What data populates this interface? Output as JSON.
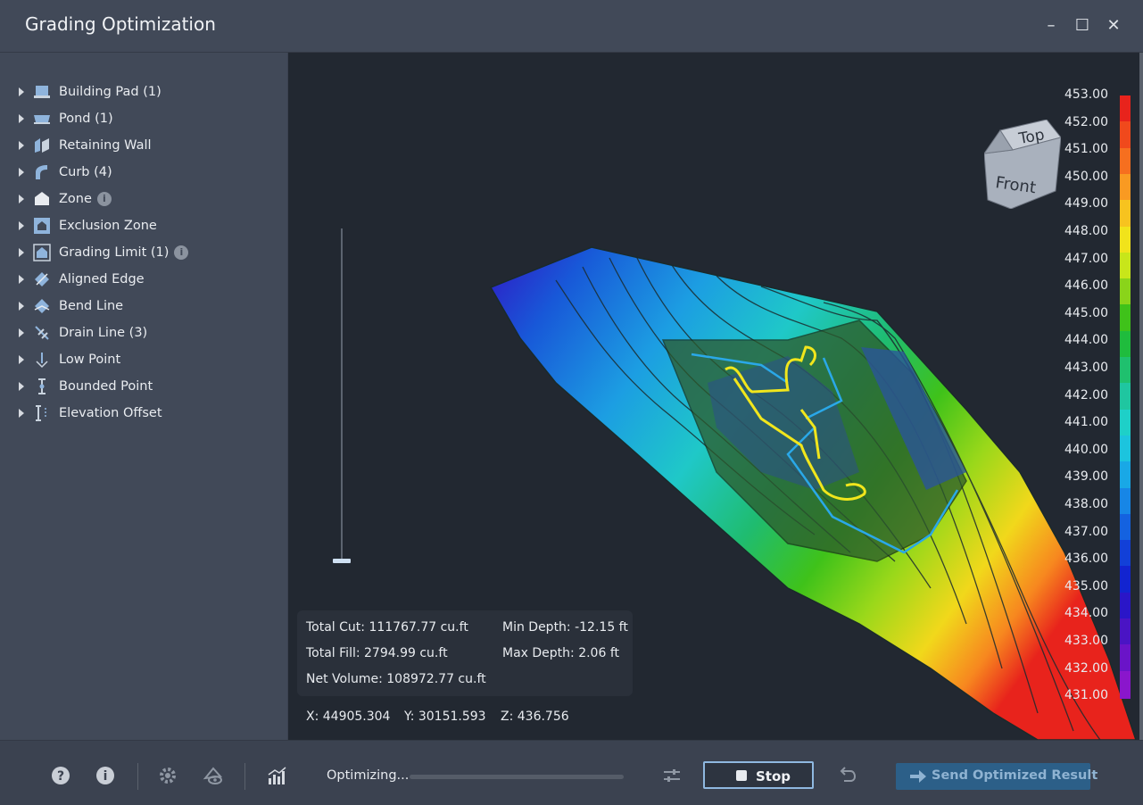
{
  "window": {
    "title": "Grading Optimization",
    "controls": {
      "minimize": "–",
      "maximize": "☐",
      "close": "✕"
    }
  },
  "sidebar": {
    "items": [
      {
        "label": "Building Pad (1)",
        "icon": "building-pad-icon",
        "info": false
      },
      {
        "label": "Pond (1)",
        "icon": "pond-icon",
        "info": false
      },
      {
        "label": "Retaining Wall",
        "icon": "retaining-wall-icon",
        "info": false
      },
      {
        "label": "Curb (4)",
        "icon": "curb-icon",
        "info": false
      },
      {
        "label": "Zone",
        "icon": "zone-icon",
        "info": true
      },
      {
        "label": "Exclusion Zone",
        "icon": "exclusion-zone-icon",
        "info": false
      },
      {
        "label": "Grading Limit (1)",
        "icon": "grading-limit-icon",
        "info": true
      },
      {
        "label": "Aligned Edge",
        "icon": "aligned-edge-icon",
        "info": false
      },
      {
        "label": "Bend Line",
        "icon": "bend-line-icon",
        "info": false
      },
      {
        "label": "Drain Line (3)",
        "icon": "drain-line-icon",
        "info": false
      },
      {
        "label": "Low Point",
        "icon": "low-point-icon",
        "info": false
      },
      {
        "label": "Bounded Point",
        "icon": "bounded-point-icon",
        "info": false
      },
      {
        "label": "Elevation Offset",
        "icon": "elevation-offset-icon",
        "info": false
      }
    ],
    "info_glyph": "i",
    "collapse_glyph": "‹"
  },
  "viewport": {
    "view_cube": {
      "top": "Top",
      "front": "Front"
    },
    "legend": {
      "labels": [
        "453.00",
        "452.00",
        "451.00",
        "450.00",
        "449.00",
        "448.00",
        "447.00",
        "446.00",
        "445.00",
        "444.00",
        "443.00",
        "442.00",
        "441.00",
        "440.00",
        "439.00",
        "438.00",
        "437.00",
        "436.00",
        "435.00",
        "434.00",
        "433.00",
        "432.00",
        "431.00"
      ],
      "colors": [
        "#e8231c",
        "#f0491c",
        "#f66f1f",
        "#f99a22",
        "#f7c31f",
        "#f1e31b",
        "#c8e61a",
        "#8ad41a",
        "#3fc21a",
        "#1fbc3d",
        "#1fc06e",
        "#1fc6a0",
        "#1ed0c8",
        "#1cc4de",
        "#19a8e6",
        "#1786e6",
        "#1462e0",
        "#1240d8",
        "#1224d0",
        "#2a16c8",
        "#4a14c4",
        "#6a14c8",
        "#8a16cc"
      ]
    },
    "stats": {
      "total_cut": "Total Cut: 111767.77 cu.ft",
      "total_fill": "Total Fill: 2794.99 cu.ft",
      "net_volume": "Net Volume: 108972.77 cu.ft",
      "min_depth": "Min Depth: -12.15 ft",
      "max_depth": "Max Depth: 2.06 ft"
    },
    "coords": {
      "x": "X:  44905.304",
      "y": "Y:  30151.593",
      "z": "Z:  436.756"
    }
  },
  "toolbar": {
    "status": "Optimizing...",
    "progress": 0,
    "stop_label": "Stop",
    "send_label": "Send Optimized Result",
    "help_glyph": "?",
    "info_glyph": "i"
  }
}
